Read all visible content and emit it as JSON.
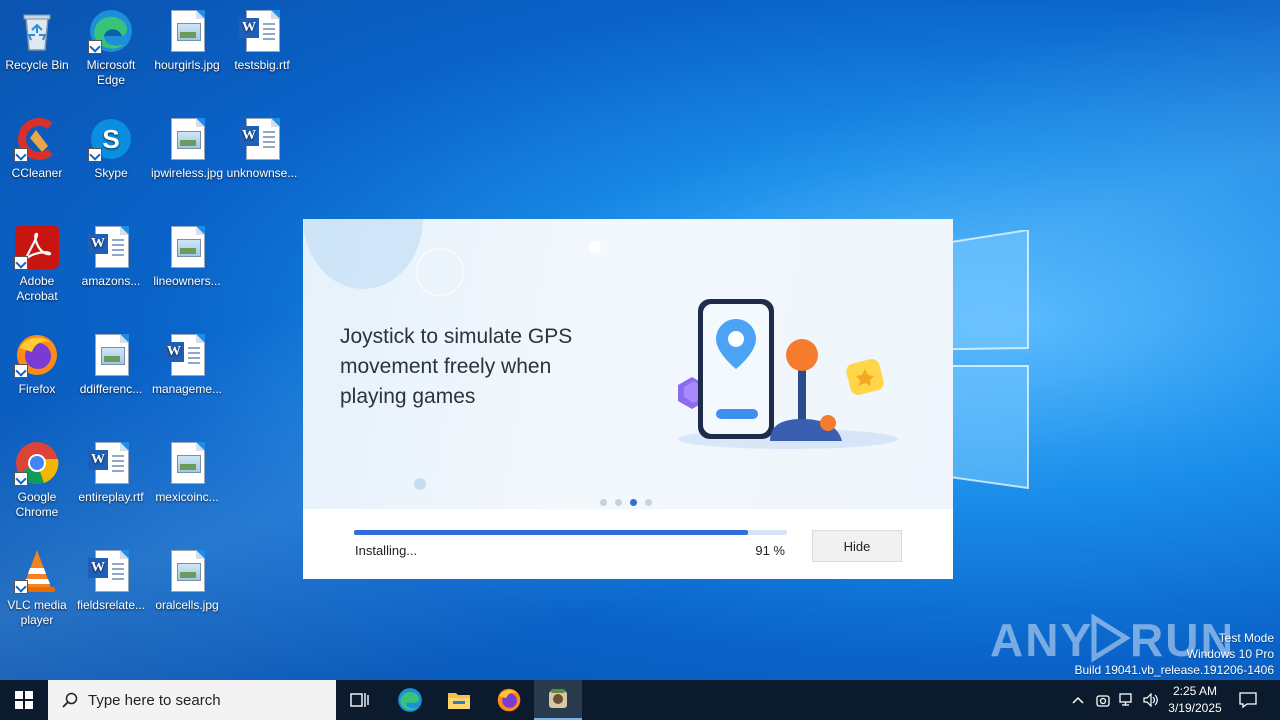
{
  "desktop": {
    "icons": [
      {
        "label": "Recycle Bin",
        "icon": "recycle-bin-icon"
      },
      {
        "label": "Microsoft Edge",
        "icon": "edge-icon"
      },
      {
        "label": "hourgirls.jpg",
        "icon": "image-file-icon"
      },
      {
        "label": "testsbig.rtf",
        "icon": "word-doc-icon"
      },
      {
        "label": "CCleaner",
        "icon": "ccleaner-icon"
      },
      {
        "label": "Skype",
        "icon": "skype-icon"
      },
      {
        "label": "ipwireless.jpg",
        "icon": "image-file-icon"
      },
      {
        "label": "unknownse...",
        "icon": "word-doc-icon"
      },
      {
        "label": "Adobe Acrobat",
        "icon": "acrobat-icon"
      },
      {
        "label": "amazons...",
        "icon": "word-doc-icon"
      },
      {
        "label": "lineowners...",
        "icon": "image-file-icon"
      },
      {
        "label": "Firefox",
        "icon": "firefox-icon"
      },
      {
        "label": "ddifferenc...",
        "icon": "image-file-icon"
      },
      {
        "label": "manageme...",
        "icon": "word-doc-icon"
      },
      {
        "label": "Google Chrome",
        "icon": "chrome-icon"
      },
      {
        "label": "entireplay.rtf",
        "icon": "word-doc-icon"
      },
      {
        "label": "mexicoinc...",
        "icon": "image-file-icon"
      },
      {
        "label": "VLC media player",
        "icon": "vlc-icon"
      },
      {
        "label": "fieldsrelate...",
        "icon": "word-doc-icon"
      },
      {
        "label": "oralcells.jpg",
        "icon": "image-file-icon"
      }
    ]
  },
  "installer": {
    "headline": "Joystick to simulate GPS movement freely when playing games",
    "pager": {
      "count": 4,
      "active_index": 2
    },
    "progress": {
      "percent": 91,
      "percent_text": "91 %"
    },
    "status": "Installing...",
    "hide_label": "Hide",
    "accent_color": "#2f6fd6"
  },
  "watermark": {
    "brand": "ANY RUN",
    "mode": "Test Mode",
    "edition": "Windows 10 Pro",
    "build": "Build 19041.vb_release.191206-1406"
  },
  "taskbar": {
    "search_placeholder": "Type here to search",
    "pinned": [
      "task-view-icon",
      "edge-icon",
      "file-explorer-icon",
      "firefox-icon",
      "installer-app-icon"
    ],
    "clock": {
      "time": "2:25 AM",
      "date": "3/19/2025"
    }
  }
}
